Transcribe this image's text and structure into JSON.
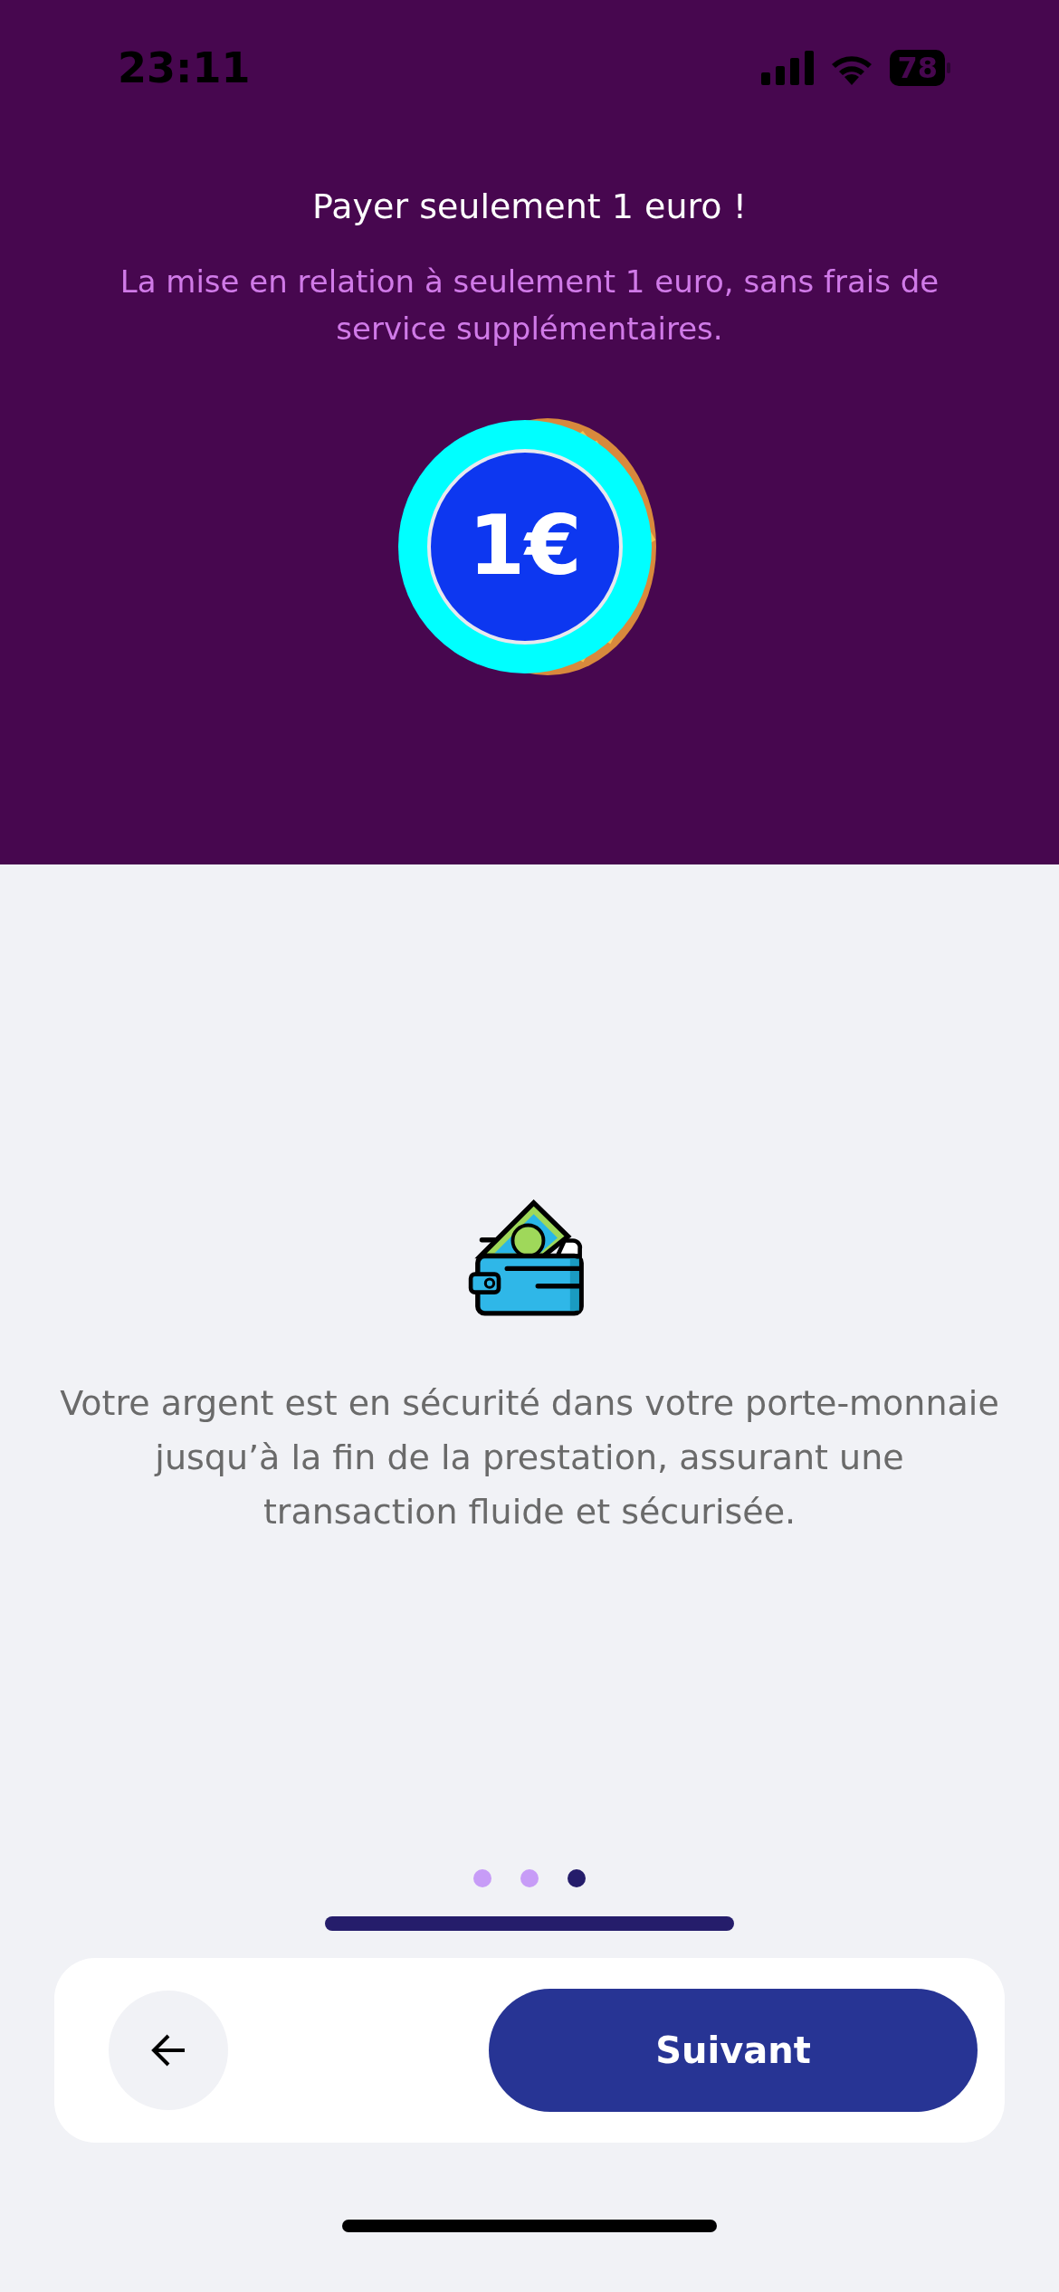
{
  "status_bar": {
    "time": "23:11",
    "battery": "78"
  },
  "header": {
    "title": "Payer seulement 1 euro !",
    "subtitle": "La mise en relation à seulement 1 euro, sans frais de service supplémentaires.",
    "coin_label": "1€"
  },
  "body": {
    "text": "Votre argent est en sécurité dans votre porte-monnaie jusqu’à la fin de la prestation, assurant une transaction fluide et sécurisée."
  },
  "pager": [
    {
      "selected": false
    },
    {
      "selected": false
    },
    {
      "selected": true
    }
  ],
  "footer": {
    "next_button": "Suivant"
  }
}
